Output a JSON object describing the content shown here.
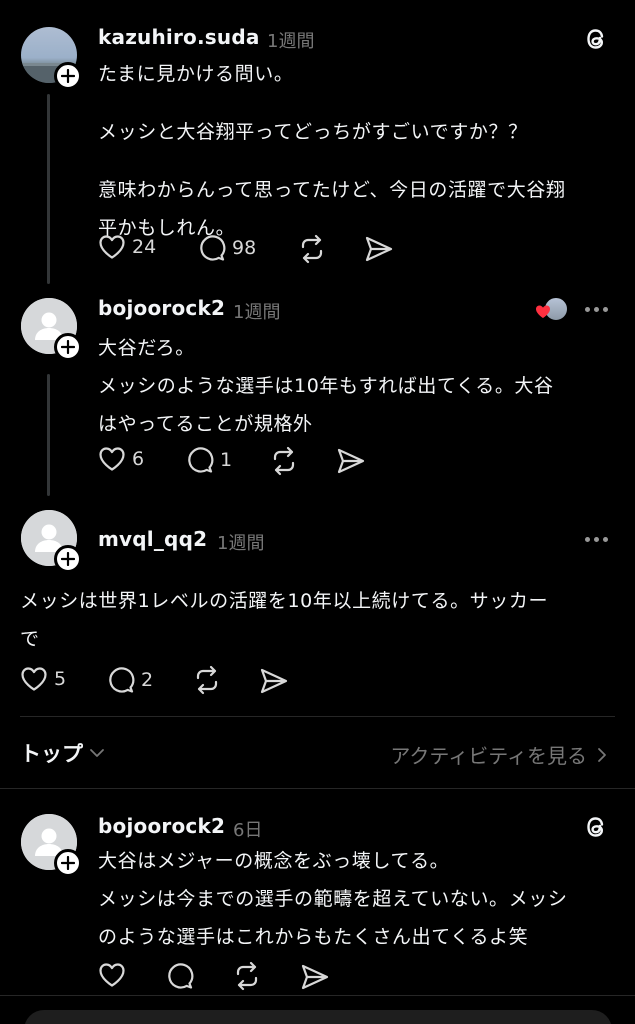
{
  "posts": [
    {
      "username": "kazuhiro.suda",
      "time": "1週間",
      "paragraphs": [
        [
          "たまに見かける問い。"
        ],
        [
          "メッシと大谷翔平ってどっちがすごいですか？？"
        ],
        [
          "意味わからんって思ってたけど、今日の活躍で大谷翔",
          "平かもしれん。"
        ]
      ],
      "likes": "24",
      "replies": "98"
    },
    {
      "username": "bojoorock2",
      "time": "1週間",
      "lines": [
        "大谷だろ。",
        "メッシのような選手は10年もすれば出てくる。大谷",
        "はやってることが規格外"
      ],
      "likes": "6",
      "replies": "1"
    },
    {
      "username": "mvql_qq2",
      "time": "1週間",
      "lines": [
        "メッシは世界1レベルの活躍を10年以上続けてる。サッカー",
        "で"
      ],
      "likes": "5",
      "replies": "2"
    },
    {
      "username": "bojoorock2",
      "time": "6日",
      "lines": [
        "大谷はメジャーの概念をぶっ壊してる。",
        "メッシは今までの選手の範疇を超えていない。メッシ",
        "のような選手はこれからもたくさん出てくるよ笑"
      ]
    }
  ],
  "tabs": {
    "top_label": "トップ",
    "activity_label": "アクティビティを見る"
  },
  "colors": {
    "background": "#000000",
    "text": "#f3f5f7",
    "muted": "#777777",
    "thread_line": "#333638",
    "heart_red": "#ff3040"
  },
  "icons": [
    "threads-logo-icon",
    "heart-icon",
    "comment-icon",
    "repost-icon",
    "share-icon",
    "more-icon",
    "plus-icon",
    "chevron-down-icon",
    "chevron-right-icon"
  ]
}
